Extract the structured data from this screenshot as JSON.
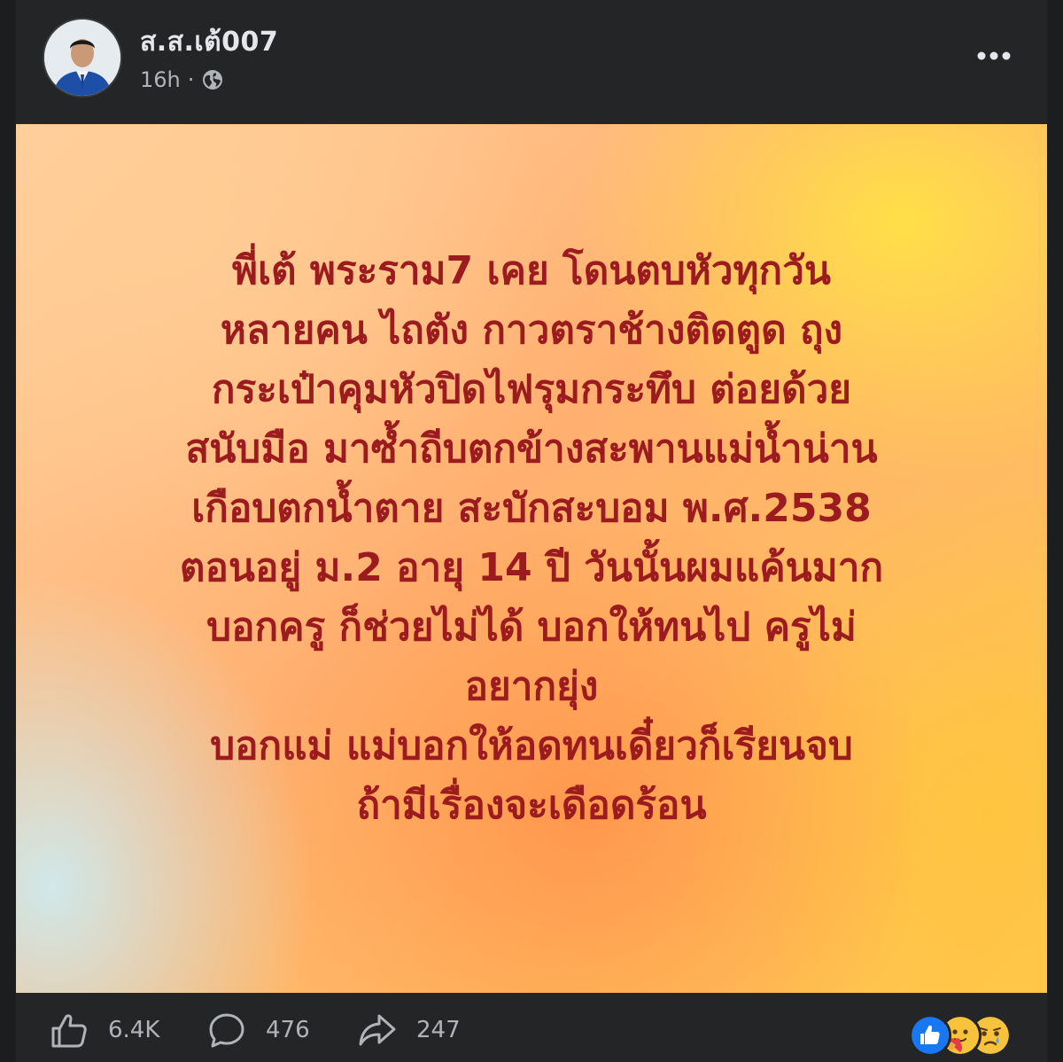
{
  "post": {
    "author": "ส.ส.เต้007",
    "time": "16h",
    "separator": "·",
    "privacy_icon": "globe-icon",
    "more_icon": "more-horizontal-icon"
  },
  "card": {
    "lines": [
      "พี่เต้ พระราม7 เคย โดนตบหัวทุกวัน",
      "หลายคน ไถตัง กาวตราช้างติดตูด ถุง",
      "กระเป๋าคุมหัวปิดไฟรุมกระทึบ ต่อยด้วย",
      "สนับมือ มาซ้ำถีบตกข้างสะพานแม่น้ำน่าน",
      "เกือบตกน้ำตาย สะบักสะบอม พ.ศ.2538",
      "ตอนอยู่ ม.2 อายุ 14 ปี วันนั้นผมแค้นมาก",
      "บอกครู ก็ช่วยไม่ได้ บอกให้ทนไป ครูไม่",
      "อยากยุ่ง",
      "บอกแม่ แม่บอกให้อดทนเดี๋ยวก็เรียนจบ",
      "ถ้ามีเรื่องจะเดือดร้อน"
    ],
    "text_color": "#9b1b1f"
  },
  "footer": {
    "likes": "6.4K",
    "comments": "476",
    "shares": "247",
    "like_icon": "thumbs-up-icon",
    "comment_icon": "comment-icon",
    "share_icon": "share-icon",
    "reactions": [
      "like-reaction-icon",
      "care-reaction-icon",
      "sad-reaction-icon"
    ]
  },
  "colors": {
    "background": "#242527",
    "text_primary": "#e4e6eb",
    "text_secondary": "#b0b3b8",
    "like_blue": "#1877f2"
  }
}
